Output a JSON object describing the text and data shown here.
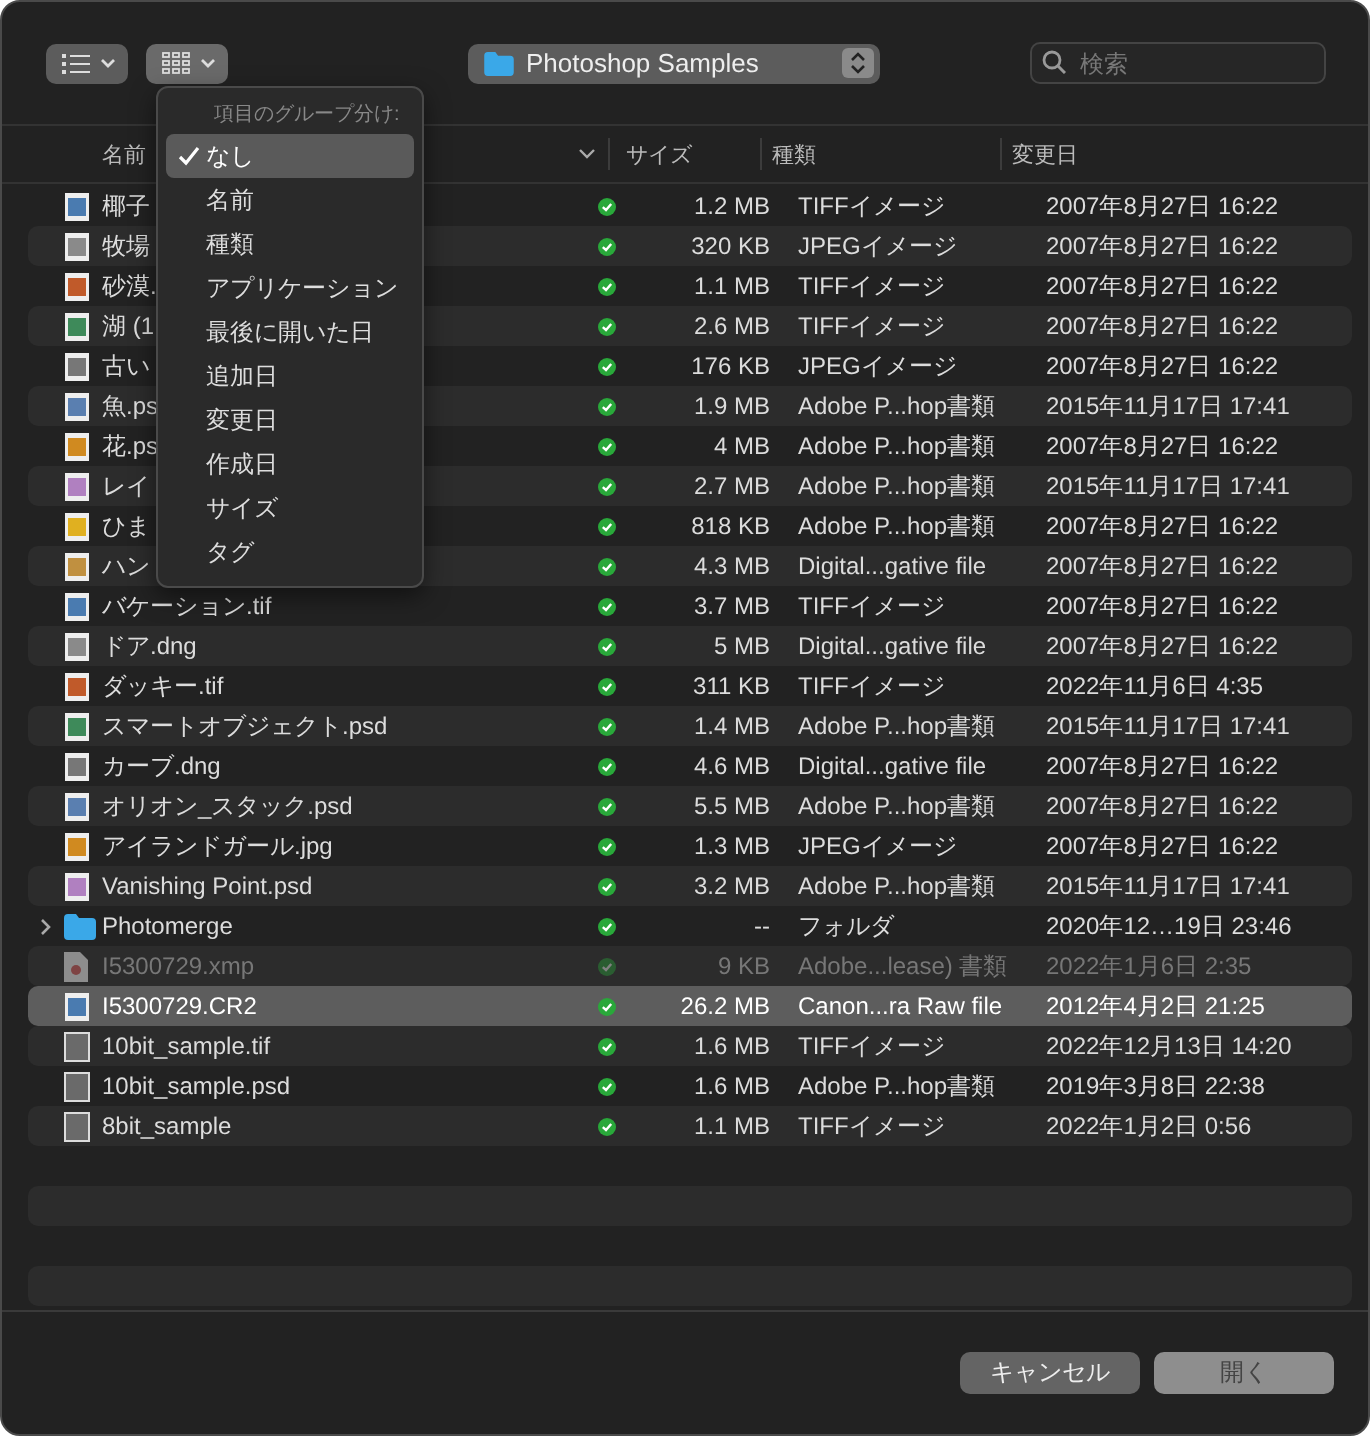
{
  "toolbar": {
    "view_button": {
      "kind": "list"
    },
    "group_button": {
      "kind": "grid",
      "expanded": true
    },
    "location": {
      "label": "Photoshop Samples"
    },
    "search": {
      "placeholder": "検索"
    }
  },
  "columns": [
    "名前",
    "サイズ",
    "種類",
    "変更日"
  ],
  "rows": [
    {
      "name": "椰子",
      "size": "1.2 MB",
      "file_type": "TIFFイメージ",
      "date": "2007年8月27日 16:22",
      "kind": "image",
      "selected": false,
      "disabled": false
    },
    {
      "name": "牧場",
      "size": "320 KB",
      "file_type": "JPEGイメージ",
      "date": "2007年8月27日 16:22",
      "kind": "image",
      "selected": false,
      "disabled": false
    },
    {
      "name": "砂漠.",
      "size": "1.1 MB",
      "file_type": "TIFFイメージ",
      "date": "2007年8月27日 16:22",
      "kind": "image",
      "selected": false,
      "disabled": false
    },
    {
      "name": "湖 (1",
      "size": "2.6 MB",
      "file_type": "TIFFイメージ",
      "date": "2007年8月27日 16:22",
      "kind": "image",
      "selected": false,
      "disabled": false
    },
    {
      "name": "古い",
      "size": "176 KB",
      "file_type": "JPEGイメージ",
      "date": "2007年8月27日 16:22",
      "kind": "image",
      "selected": false,
      "disabled": false
    },
    {
      "name": "魚.ps",
      "size": "1.9 MB",
      "file_type": "Adobe P...hop書類",
      "date": "2015年11月17日 17:41",
      "kind": "image",
      "selected": false,
      "disabled": false
    },
    {
      "name": "花.ps",
      "size": "4 MB",
      "file_type": "Adobe P...hop書類",
      "date": "2007年8月27日 16:22",
      "kind": "image",
      "selected": false,
      "disabled": false
    },
    {
      "name": "レイ",
      "size": "2.7 MB",
      "file_type": "Adobe P...hop書類",
      "date": "2015年11月17日 17:41",
      "kind": "image",
      "selected": false,
      "disabled": false
    },
    {
      "name": "ひま",
      "size": "818 KB",
      "file_type": "Adobe P...hop書類",
      "date": "2007年8月27日 16:22",
      "kind": "image",
      "selected": false,
      "disabled": false
    },
    {
      "name": "ハン",
      "size": "4.3 MB",
      "file_type": "Digital...gative file",
      "date": "2007年8月27日 16:22",
      "kind": "image",
      "selected": false,
      "disabled": false
    },
    {
      "name": "バケーション.tif",
      "size": "3.7 MB",
      "file_type": "TIFFイメージ",
      "date": "2007年8月27日 16:22",
      "kind": "image",
      "selected": false,
      "disabled": false
    },
    {
      "name": "ドア.dng",
      "size": "5 MB",
      "file_type": "Digital...gative file",
      "date": "2007年8月27日 16:22",
      "kind": "image",
      "selected": false,
      "disabled": false
    },
    {
      "name": "ダッキー.tif",
      "size": "311 KB",
      "file_type": "TIFFイメージ",
      "date": "2022年11月6日 4:35",
      "kind": "image",
      "selected": false,
      "disabled": false
    },
    {
      "name": "スマートオブジェクト.psd",
      "size": "1.4 MB",
      "file_type": "Adobe P...hop書類",
      "date": "2015年11月17日 17:41",
      "kind": "image",
      "selected": false,
      "disabled": false
    },
    {
      "name": "カーブ.dng",
      "size": "4.6 MB",
      "file_type": "Digital...gative file",
      "date": "2007年8月27日 16:22",
      "kind": "image",
      "selected": false,
      "disabled": false
    },
    {
      "name": "オリオン_スタック.psd",
      "size": "5.5 MB",
      "file_type": "Adobe P...hop書類",
      "date": "2007年8月27日 16:22",
      "kind": "image",
      "selected": false,
      "disabled": false
    },
    {
      "name": "アイランドガール.jpg",
      "size": "1.3 MB",
      "file_type": "JPEGイメージ",
      "date": "2007年8月27日 16:22",
      "kind": "image",
      "selected": false,
      "disabled": false
    },
    {
      "name": "Vanishing Point.psd",
      "size": "3.2 MB",
      "file_type": "Adobe P...hop書類",
      "date": "2015年11月17日 17:41",
      "kind": "image",
      "selected": false,
      "disabled": false
    },
    {
      "name": "Photomerge",
      "size": "--",
      "file_type": "フォルダ",
      "date": "2020年12…19日 23:46",
      "kind": "folder",
      "expanded": false,
      "selected": false,
      "disabled": false
    },
    {
      "name": "I5300729.xmp",
      "size": "9 KB",
      "file_type": "Adobe...lease) 書類",
      "date": "2022年1月6日 2:35",
      "kind": "document",
      "selected": false,
      "disabled": true
    },
    {
      "name": "I5300729.CR2",
      "size": "26.2 MB",
      "file_type": "Canon...ra Raw file",
      "date": "2012年4月2日 21:25",
      "kind": "image",
      "selected": true,
      "disabled": false
    },
    {
      "name": "10bit_sample.tif",
      "size": "1.6 MB",
      "file_type": "TIFFイメージ",
      "date": "2022年12月13日 14:20",
      "kind": "blank",
      "selected": false,
      "disabled": false
    },
    {
      "name": "10bit_sample.psd",
      "size": "1.6 MB",
      "file_type": "Adobe P...hop書類",
      "date": "2019年3月8日 22:38",
      "kind": "blank",
      "selected": false,
      "disabled": false
    },
    {
      "name": "8bit_sample",
      "size": "1.1 MB",
      "file_type": "TIFFイメージ",
      "date": "2022年1月2日 0:56",
      "kind": "blank",
      "selected": false,
      "disabled": false
    }
  ],
  "group_menu": {
    "title": "項目のグループ分け:",
    "items": [
      {
        "label": "なし",
        "selected": true
      },
      {
        "label": "名前",
        "selected": false
      },
      {
        "label": "種類",
        "selected": false
      },
      {
        "label": "アプリケーション",
        "selected": false
      },
      {
        "label": "最後に開いた日",
        "selected": false
      },
      {
        "label": "追加日",
        "selected": false
      },
      {
        "label": "変更日",
        "selected": false
      },
      {
        "label": "作成日",
        "selected": false
      },
      {
        "label": "サイズ",
        "selected": false
      },
      {
        "label": "タグ",
        "selected": false
      }
    ]
  },
  "buttons": [
    {
      "label": "キャンセル",
      "disabled": false
    },
    {
      "label": "開く",
      "disabled": true
    }
  ]
}
